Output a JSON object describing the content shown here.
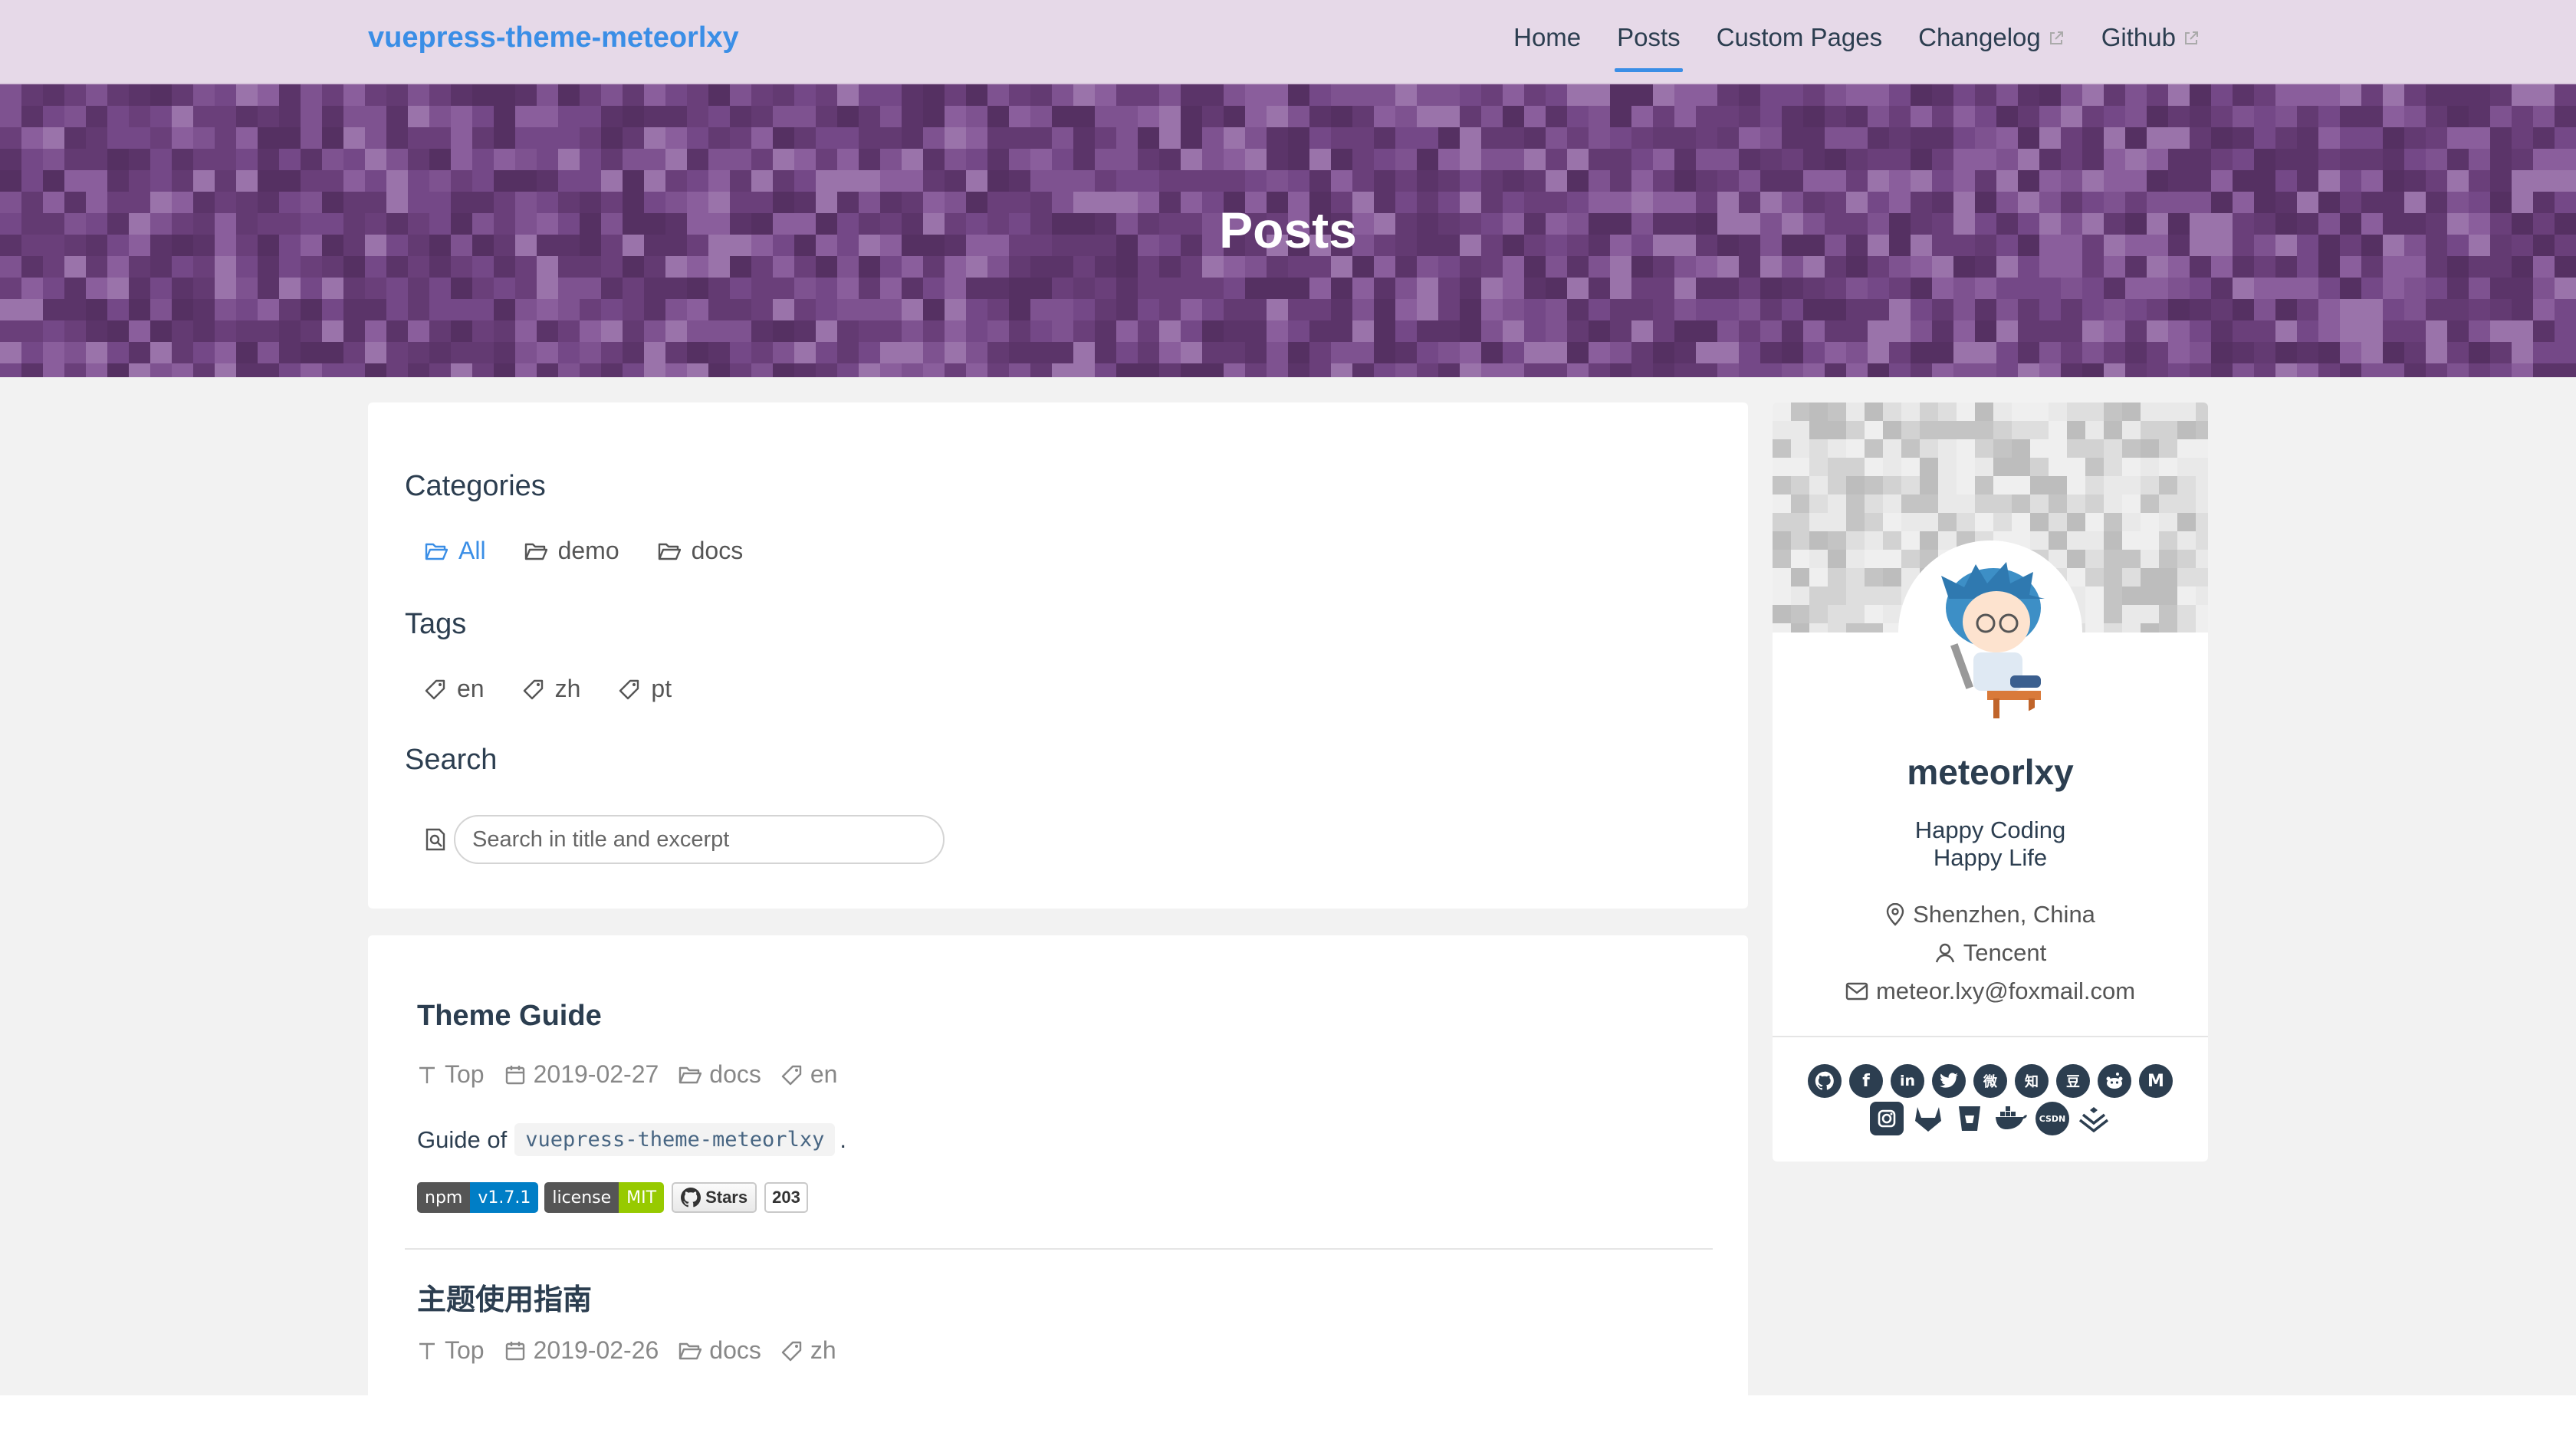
{
  "navbar": {
    "brand": "vuepress-theme-meteorlxy",
    "links": [
      {
        "label": "Home",
        "active": false,
        "external": false
      },
      {
        "label": "Posts",
        "active": true,
        "external": false
      },
      {
        "label": "Custom Pages",
        "active": false,
        "external": false
      },
      {
        "label": "Changelog",
        "active": false,
        "external": true
      },
      {
        "label": "Github",
        "active": false,
        "external": true
      }
    ]
  },
  "hero": {
    "title": "Posts"
  },
  "filters": {
    "categories_title": "Categories",
    "categories": [
      "All",
      "demo",
      "docs"
    ],
    "active_category": "All",
    "tags_title": "Tags",
    "tags": [
      "en",
      "zh",
      "pt"
    ],
    "search_title": "Search",
    "search_placeholder": "Search in title and excerpt"
  },
  "posts": [
    {
      "title": "Theme Guide",
      "top": "Top",
      "date": "2019-02-27",
      "category": "docs",
      "tag": "en",
      "excerpt_prefix": "Guide of",
      "excerpt_code": "vuepress-theme-meteorlxy",
      "excerpt_suffix": ".",
      "badges": {
        "npm_label": "npm",
        "npm_value": "v1.7.1",
        "license_label": "license",
        "license_value": "MIT",
        "stars_label": "Stars",
        "stars_count": "203"
      }
    },
    {
      "title": "主题使用指南",
      "top": "Top",
      "date": "2019-02-26",
      "category": "docs",
      "tag": "zh"
    }
  ],
  "profile": {
    "name": "meteorlxy",
    "bio_line1": "Happy Coding",
    "bio_line2": "Happy Life",
    "location": "Shenzhen, China",
    "organization": "Tencent",
    "email": "meteor.lxy@foxmail.com",
    "social_row1": [
      "github-icon",
      "facebook-icon",
      "linkedin-icon",
      "twitter-icon",
      "weibo-icon",
      "zhihu-icon",
      "douban-icon",
      "reddit-icon",
      "medium-icon"
    ],
    "social_row2": [
      "instagram-icon",
      "gitlab-icon",
      "bitbucket-icon",
      "docker-icon",
      "csdn-icon",
      "juejin-icon"
    ]
  },
  "colors": {
    "accent": "#3a8ee6",
    "navbar_bg": "#e6d9e8",
    "hero_bg": "#6a3f7a",
    "text": "#2c3e50"
  }
}
